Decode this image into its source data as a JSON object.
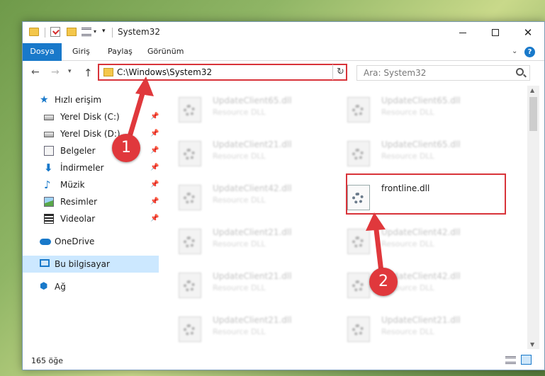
{
  "window": {
    "title": "System32",
    "controls": {
      "minimize": "minimize",
      "maximize": "maximize",
      "close": "✕"
    }
  },
  "ribbon": {
    "tabs": [
      "Dosya",
      "Giriş",
      "Paylaş",
      "Görünüm"
    ],
    "help": "?"
  },
  "address": {
    "path": "C:\\Windows\\System32",
    "search_placeholder": "Ara: System32"
  },
  "navpane": {
    "quick_access": "Hızlı erişim",
    "items": [
      {
        "label": "Yerel Disk (C:)",
        "icon": "disk-icon"
      },
      {
        "label": "Yerel Disk (D:)",
        "icon": "disk-icon"
      },
      {
        "label": "Belgeler",
        "icon": "documents-icon"
      },
      {
        "label": "İndirmeler",
        "icon": "downloads-icon"
      },
      {
        "label": "Müzik",
        "icon": "music-icon"
      },
      {
        "label": "Resimler",
        "icon": "pictures-icon"
      },
      {
        "label": "Videolar",
        "icon": "videos-icon"
      }
    ],
    "onedrive": "OneDrive",
    "this_pc": "Bu bilgisayar",
    "network": "Ağ"
  },
  "files": [
    {
      "name": "UpdateClient65.dll",
      "type": "Resource DLL"
    },
    {
      "name": "UpdateClient65.dll",
      "type": "Resource DLL"
    },
    {
      "name": "UpdateClient21.dll",
      "type": "Resource DLL"
    },
    {
      "name": "UpdateClient65.dll",
      "type": "Resource DLL"
    },
    {
      "name": "UpdateClient42.dll",
      "type": "Resource DLL"
    },
    {
      "name": "frontline.dll",
      "type": ""
    },
    {
      "name": "UpdateClient21.dll",
      "type": "Resource DLL"
    },
    {
      "name": "UpdateClient42.dll",
      "type": "Resource DLL"
    },
    {
      "name": "UpdateClient21.dll",
      "type": "Resource DLL"
    },
    {
      "name": "UpdateClient42.dll",
      "type": "Resource DLL"
    },
    {
      "name": "UpdateClient21.dll",
      "type": "Resource DLL"
    },
    {
      "name": "UpdateClient21.dll",
      "type": "Resource DLL"
    }
  ],
  "status": {
    "item_count": "165 öğe"
  },
  "annotations": {
    "step1": "1",
    "step2": "2",
    "color": "#e0383c"
  }
}
